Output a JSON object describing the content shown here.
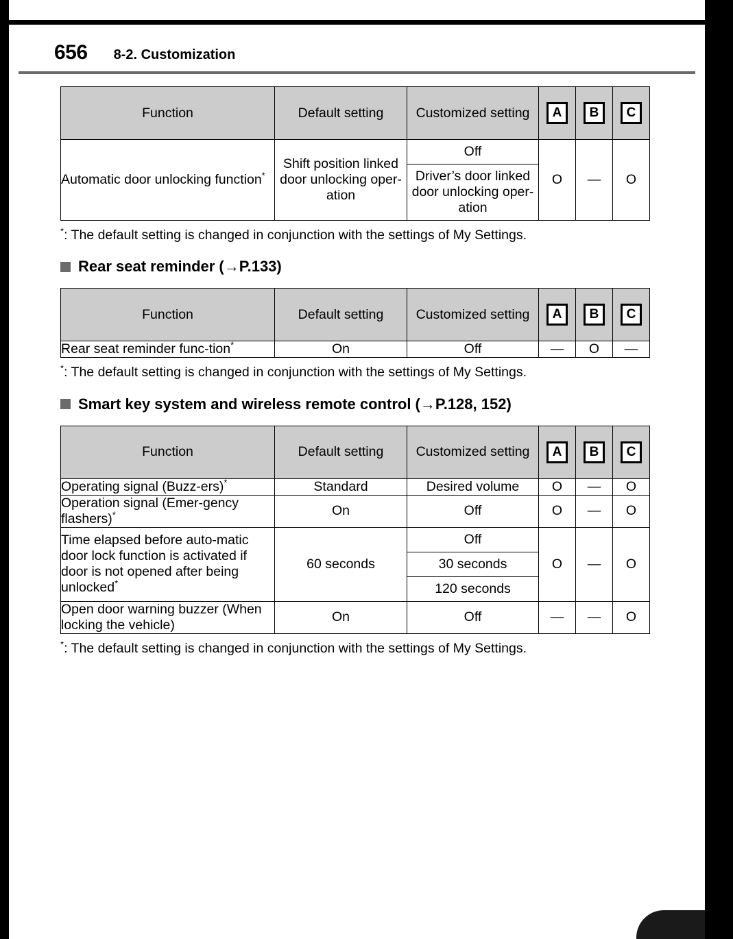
{
  "page": {
    "number": "656",
    "section": "8-2. Customization"
  },
  "table_headers": {
    "function": "Function",
    "default_setting": "Default setting",
    "customized_setting": "Customized setting",
    "a": "A",
    "b": "B",
    "c": "C"
  },
  "footnote_text": ": The default setting is changed in conjunction with the settings of My Settings.",
  "footnote_marker": "*",
  "sections": [
    {
      "id": "automatic-door-unlocking",
      "heading": null,
      "rows": [
        {
          "function": "Automatic door unlocking function",
          "function_has_asterisk": true,
          "default": "Shift position linked door unlocking oper-ation",
          "customized": [
            "Off",
            "Driver’s door linked door unlocking oper-ation"
          ],
          "a": "O",
          "b": "—",
          "c": "O"
        }
      ]
    },
    {
      "id": "rear-seat-reminder",
      "heading": "Rear seat reminder (→P.133)",
      "rows": [
        {
          "function": "Rear seat reminder func-tion",
          "function_has_asterisk": true,
          "default": "On",
          "customized": [
            "Off"
          ],
          "a": "—",
          "b": "O",
          "c": "—"
        }
      ]
    },
    {
      "id": "smart-key-system",
      "heading": "Smart key system and wireless remote control (→P.128, 152)",
      "rows": [
        {
          "function": "Operating signal (Buzz-ers)",
          "function_has_asterisk": true,
          "default": "Standard",
          "customized": [
            "Desired volume"
          ],
          "a": "O",
          "b": "—",
          "c": "O"
        },
        {
          "function": "Operation signal (Emer-gency flashers)",
          "function_has_asterisk": true,
          "default": "On",
          "customized": [
            "Off"
          ],
          "a": "O",
          "b": "—",
          "c": "O"
        },
        {
          "function": "Time elapsed before auto-matic door lock function is activated if door is not opened after being unlocked",
          "function_has_asterisk": true,
          "default": "60 seconds",
          "customized": [
            "Off",
            "30 seconds",
            "120 seconds"
          ],
          "a": "O",
          "b": "—",
          "c": "O"
        },
        {
          "function": "Open door warning buzzer (When locking the vehicle)",
          "function_has_asterisk": false,
          "default": "On",
          "customized": [
            "Off"
          ],
          "a": "—",
          "b": "—",
          "c": "O"
        }
      ]
    }
  ],
  "colors": {
    "header_fill": "#cccccc",
    "bullet": "#6b6b6b",
    "rule": "#6b6b6b",
    "scan_edge": "#000000"
  }
}
